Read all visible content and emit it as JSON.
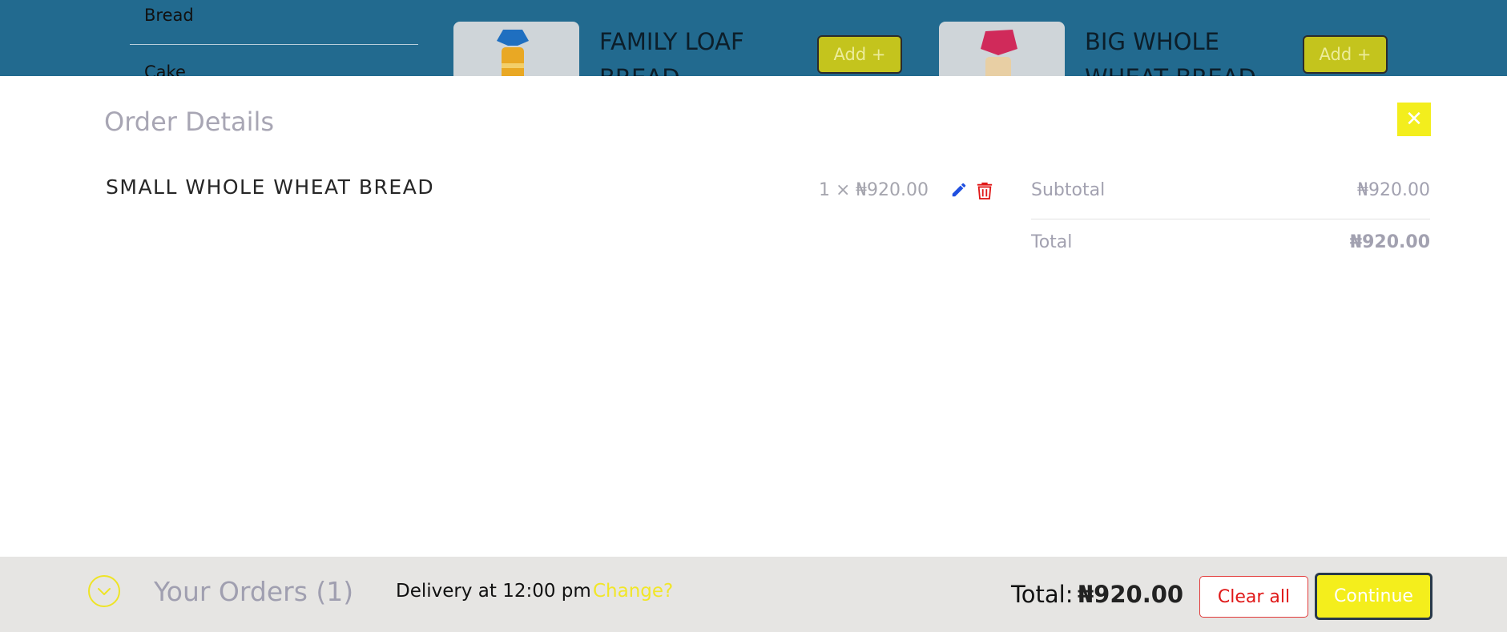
{
  "background": {
    "categories": [
      "Bread",
      "Cake"
    ],
    "products": [
      {
        "name": "FAMILY LOAF BREAD",
        "add_label": "Add +"
      },
      {
        "name": "BIG WHOLE WHEAT BREAD",
        "add_label": "Add +"
      }
    ]
  },
  "order_panel": {
    "title": "Order Details",
    "close_label": "✕",
    "items": [
      {
        "name": "SMALL WHOLE WHEAT BREAD",
        "qty": "1 ×",
        "price": "₦920.00"
      }
    ],
    "summary": {
      "subtotal_label": "Subtotal",
      "subtotal_value": "₦920.00",
      "total_label": "Total",
      "total_value": "₦920.00"
    }
  },
  "bottom_bar": {
    "orders_label": "Your Orders (1)",
    "delivery_text": "Delivery at 12:00 pm",
    "change_label": "Change?",
    "total_label": "Total:",
    "total_value": "₦920.00",
    "clear_label": "Clear all",
    "continue_label": "Continue"
  },
  "colors": {
    "header_bg": "#226a8f",
    "accent_yellow": "#f4ee1c",
    "danger_red": "#e01818",
    "edit_blue": "#1f4fe0"
  },
  "icons": [
    "close-icon",
    "edit-icon",
    "delete-icon",
    "chevron-down-icon"
  ]
}
